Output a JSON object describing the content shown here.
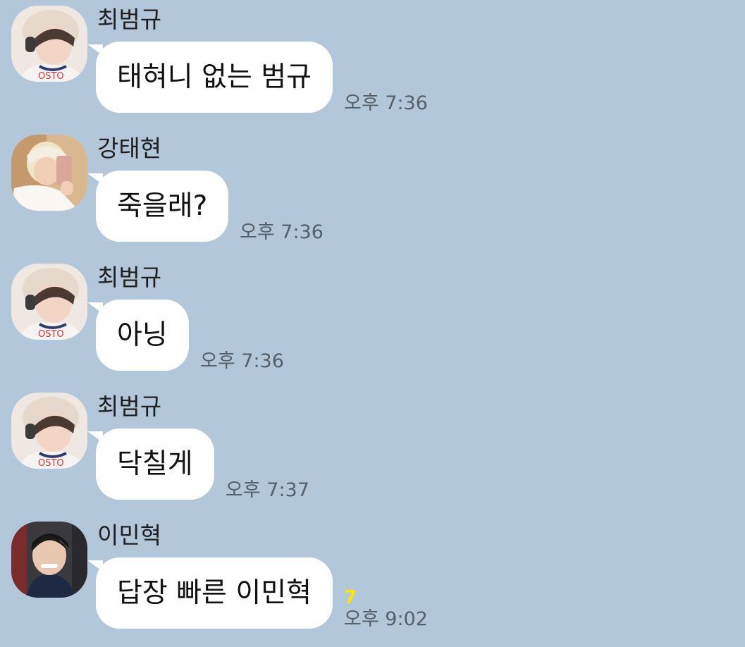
{
  "messages": [
    {
      "sender": "최범규",
      "text": "태혀니 없는 범규",
      "time": "오후 7:36",
      "avatar": "beomgyu-avatar"
    },
    {
      "sender": "강태현",
      "text": "죽을래?",
      "time": "오후 7:36",
      "avatar": "taehyun-avatar"
    },
    {
      "sender": "최범규",
      "text": "아닝",
      "time": "오후 7:36",
      "avatar": "beomgyu-avatar"
    },
    {
      "sender": "최범규",
      "text": "닥칠게",
      "time": "오후 7:37",
      "avatar": "beomgyu-avatar"
    },
    {
      "sender": "이민혁",
      "text": "답장 빠른 이민혁",
      "time": "오후 9:02",
      "unread": "7",
      "avatar": "minhyuk-avatar"
    }
  ],
  "colors": {
    "background": "#b2c7d9",
    "bubble": "#ffffff",
    "time": "#55606b",
    "unread": "#f7e600"
  }
}
